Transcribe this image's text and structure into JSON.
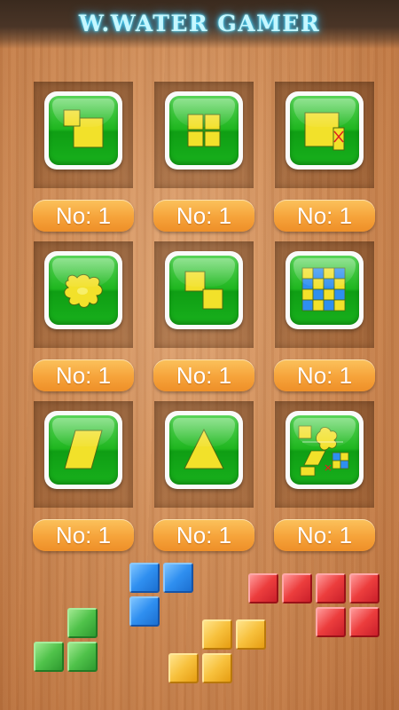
{
  "header": {
    "title": "W.WATER GAMER"
  },
  "levels": [
    {
      "label": "No: 1",
      "icon": "small-square-in-square-icon"
    },
    {
      "label": "No: 1",
      "icon": "four-squares-icon"
    },
    {
      "label": "No: 1",
      "icon": "square-with-cut-strip-icon"
    },
    {
      "label": "No: 1",
      "icon": "splat-blob-icon"
    },
    {
      "label": "No: 1",
      "icon": "diagonal-squares-icon"
    },
    {
      "label": "No: 1",
      "icon": "checker-grid-icon"
    },
    {
      "label": "No: 1",
      "icon": "parallelogram-icon"
    },
    {
      "label": "No: 1",
      "icon": "triangle-icon"
    },
    {
      "label": "No: 1",
      "icon": "mixed-shapes-icon"
    }
  ],
  "colors": {
    "title_glow": "#3fd7ff",
    "tile_green": "#1fb61f",
    "shape_yellow": "#f2e12a",
    "button_orange": "#f6a33a"
  },
  "decorations": [
    "blue-tetromino",
    "green-tetromino",
    "yellow-tetromino",
    "red-tetromino"
  ]
}
